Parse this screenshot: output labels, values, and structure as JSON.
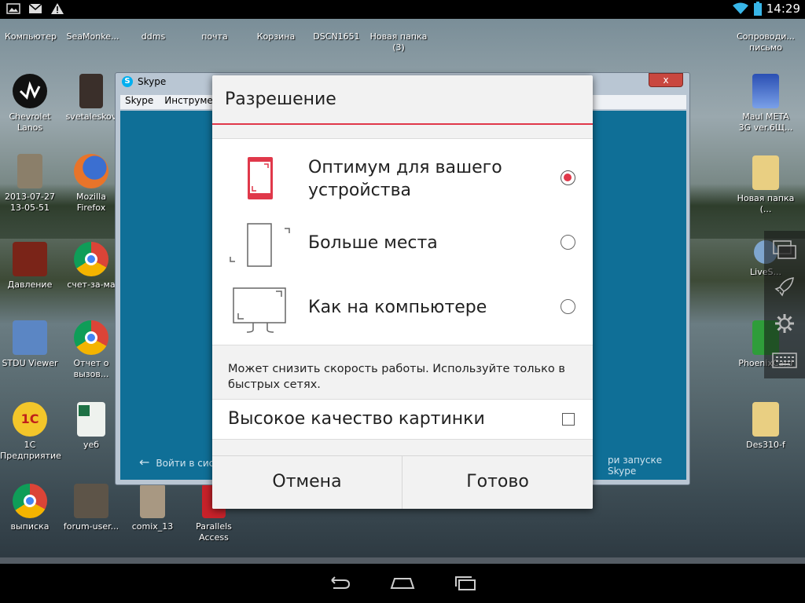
{
  "statusbar": {
    "left_icons": [
      "image-notification-icon",
      "mail-icon",
      "warning-icon"
    ],
    "right_icons": [
      "wifi-icon",
      "battery-icon"
    ],
    "time": "14:29"
  },
  "desktop": {
    "top_labels": [
      "Компьютер",
      "SeaMonke...",
      "ddms",
      "почта",
      "Корзина",
      "DSCN1651",
      "Новая папка (3)",
      "Сопроводи... письмо"
    ],
    "icons": [
      {
        "label": "Chevrolet Lanos",
        "icon": "chevrolet-icon"
      },
      {
        "label": "svetaleskov",
        "icon": "photo-icon"
      },
      {
        "label": "2013-07-27 13-05-51",
        "icon": "photo-icon"
      },
      {
        "label": "Mozilla Firefox",
        "icon": "firefox-icon"
      },
      {
        "label": "Давление",
        "icon": "document-icon"
      },
      {
        "label": "счет-за-ма",
        "icon": "chrome-icon"
      },
      {
        "label": "STDU Viewer",
        "icon": "stdu-viewer-icon"
      },
      {
        "label": "Отчет о вызов...",
        "icon": "chrome-icon"
      },
      {
        "label": "1С Предприятие",
        "icon": "1c-icon"
      },
      {
        "label": "уеб",
        "icon": "excel-icon"
      },
      {
        "label": "выписка",
        "icon": "chrome-icon"
      },
      {
        "label": "forum-user...",
        "icon": "photo-icon"
      },
      {
        "label": "comix_13",
        "icon": "photo-icon"
      },
      {
        "label": "Parallels Access",
        "icon": "parallels-icon"
      },
      {
        "label": "Maul META 3G ver.6Щ...",
        "icon": "building-icon"
      },
      {
        "label": "Новая папка (...",
        "icon": "folder-icon"
      },
      {
        "label": "LiveS...",
        "icon": "globe-icon"
      },
      {
        "label": "PhoenixCard",
        "icon": "phoenixcard-icon"
      },
      {
        "label": "Des310-f",
        "icon": "folder-icon"
      }
    ]
  },
  "skype": {
    "title": "Skype",
    "close": "x",
    "menu": [
      "Skype",
      "Инструмент"
    ],
    "signin": "Войти в сис",
    "right_text": "ри запуске Skype"
  },
  "dialog": {
    "title": "Разрешение",
    "options": [
      {
        "label": "Оптимум для вашего устройства",
        "selected": true,
        "icon": "phone-screen-icon"
      },
      {
        "label": "Больше места",
        "selected": false,
        "icon": "tall-screen-icon"
      },
      {
        "label": "Как на компьютере",
        "selected": false,
        "icon": "monitor-icon"
      }
    ],
    "note": "Может снизить скорость работы. Используйте только в быстрых сетях.",
    "hq_label": "Высокое качество картинки",
    "hq_checked": false,
    "cancel": "Отмена",
    "done": "Готово",
    "accent": "#e0384a"
  },
  "sidebar": [
    "screens-icon",
    "rocket-icon",
    "gear-icon",
    "keyboard-icon"
  ],
  "navbar": [
    "back-icon",
    "home-icon",
    "recent-apps-icon"
  ]
}
